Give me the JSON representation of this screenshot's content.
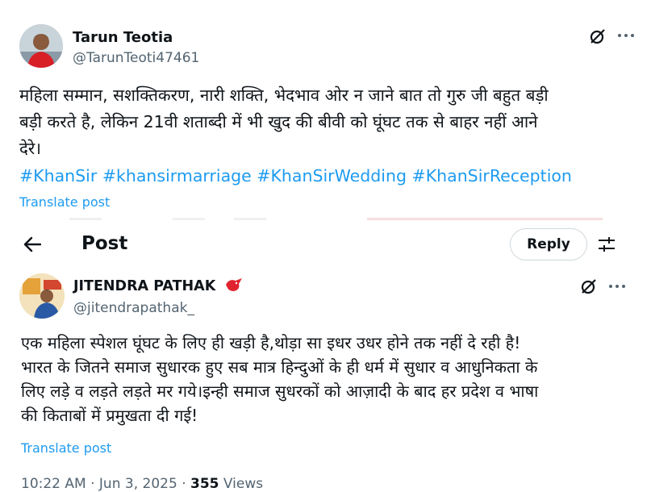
{
  "tweet_top": {
    "name": "Tarun Teotia",
    "handle": "@TarunTeoti47461",
    "text_lines": [
      "महिला सम्मान, सशक्तिकरण, नारी शक्ति, भेदभाव ओर न जाने बात तो गुरु जी बहुत बड़ी",
      "बड़ी करते है, लेकिन 21वी शताब्दी में भी खुद की बीवी को घूंघट तक से बाहर नहीं आने",
      "देरे।"
    ],
    "hashtags": "#KhanSir #khansirmarriage #KhanSirWedding #KhanSirReception",
    "translate": "Translate post",
    "icons": [
      "grok-icon",
      "more-icon"
    ]
  },
  "header": {
    "back_icon": "back-arrow-icon",
    "title": "Post",
    "reply_label": "Reply",
    "settings_icon": "sliders-icon"
  },
  "tweet_main": {
    "name": "JITENDRA PATHAK",
    "badge_icon": "red-bird-icon",
    "handle": "@jitendrapathak_",
    "text_lines": [
      "एक महिला स्पेशल घूंघट के लिए ही खड़ी है,थोड़ा सा इधर उधर होने तक नहीं दे रही है!",
      "भारत के जितने समाज सुधारक हुए सब मात्र हिन्दुओं के ही धर्म में सुधार व आधुनिकता के",
      "लिए लड़े व लड़ते लड़ते मर गये।इन्ही समाज सुधरकों को आज़ादी के बाद हर प्रदेश व भाषा",
      "की किताबों में प्रमुखता दी गई!"
    ],
    "translate": "Translate post",
    "time": "10:22 AM",
    "date": "Jun 3, 2025",
    "views_count": "355",
    "views_label": "Views",
    "icons": [
      "grok-icon",
      "more-icon"
    ],
    "colors": {
      "link": "#1d9bf0",
      "secondary": "#536471",
      "text": "#0f1419"
    }
  }
}
